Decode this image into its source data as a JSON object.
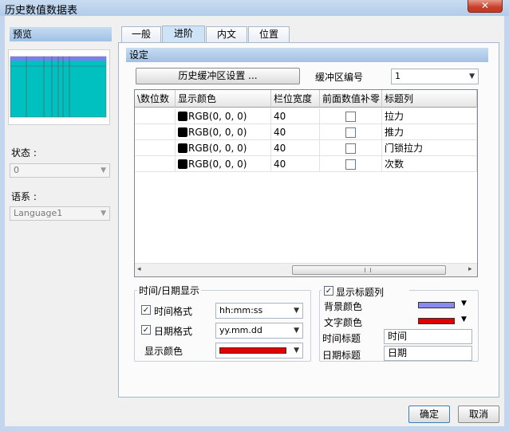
{
  "window": {
    "title": "历史数值数据表",
    "close_label": "✕"
  },
  "sidebar": {
    "preview_label": "预览",
    "state_label": "状态 :",
    "state_value": "0",
    "language_label": "语系 :",
    "language_value": "Language1"
  },
  "tabs": [
    {
      "label": "一般"
    },
    {
      "label": "进阶"
    },
    {
      "label": "内文"
    },
    {
      "label": "位置"
    }
  ],
  "settings": {
    "section_label": "设定",
    "buffer_button": "历史缓冲区设置 ...",
    "buffer_no_label": "缓冲区编号",
    "buffer_no_value": "1"
  },
  "table": {
    "headers": [
      "\\数位数",
      "显示颜色",
      "栏位宽度",
      "前面数值补零",
      "标题列"
    ],
    "rows": [
      {
        "color": "RGB(0, 0, 0)",
        "width": "40",
        "title": "拉力"
      },
      {
        "color": "RGB(0, 0, 0)",
        "width": "40",
        "title": "推力"
      },
      {
        "color": "RGB(0, 0, 0)",
        "width": "40",
        "title": "门锁拉力"
      },
      {
        "color": "RGB(0, 0, 0)",
        "width": "40",
        "title": "次数"
      }
    ]
  },
  "time_group": {
    "title": "时间/日期显示",
    "time_format_label": "时间格式",
    "time_format_value": "hh:mm:ss",
    "date_format_label": "日期格式",
    "date_format_value": "yy.mm.dd",
    "color_label": "显示颜色",
    "color_value": "#e00000"
  },
  "title_group": {
    "checkbox_label": "显示标题列",
    "bg_color_label": "背景颜色",
    "bg_color_value": "#8b8bef",
    "text_color_label": "文字颜色",
    "text_color_value": "#e00000",
    "time_title_label": "时间标题",
    "time_title_value": "时间",
    "date_title_label": "日期标题",
    "date_title_value": "日期"
  },
  "footer": {
    "ok_label": "确定",
    "cancel_label": "取消"
  }
}
